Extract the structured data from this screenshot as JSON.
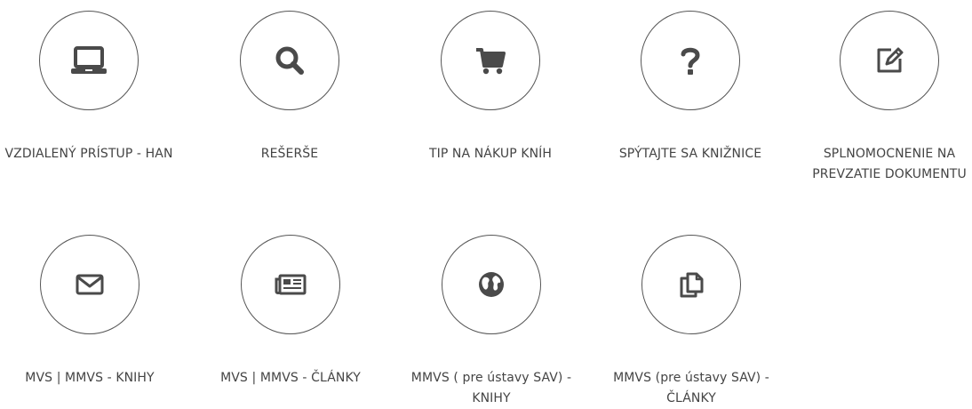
{
  "colors": {
    "icon": "#4a4a4a",
    "circle_border": "#555555",
    "text": "#444444",
    "background": "#ffffff"
  },
  "services": [
    {
      "label": "VZDIALENÝ PRÍSTUP - HAN",
      "icon": "laptop-icon"
    },
    {
      "label": "REŠERŠE",
      "icon": "search-icon"
    },
    {
      "label": "TIP NA NÁKUP KNÍH",
      "icon": "shopping-cart-icon"
    },
    {
      "label": "SPÝTAJTE SA KNIŽNICE",
      "icon": "question-mark-icon"
    },
    {
      "label": "SPLNOMOCNENIE NA PREVZATIE DOKUMENTU",
      "icon": "edit-icon"
    },
    {
      "label": "MVS | MMVS - KNIHY",
      "icon": "envelope-icon"
    },
    {
      "label": "MVS | MMVS - ČLÁNKY",
      "icon": "newspaper-icon"
    },
    {
      "label": "MMVS ( pre ústavy SAV) - KNIHY",
      "icon": "globe-icon"
    },
    {
      "label": "MMVS (pre ústavy SAV) - ČLÁNKY",
      "icon": "copy-icon"
    }
  ]
}
